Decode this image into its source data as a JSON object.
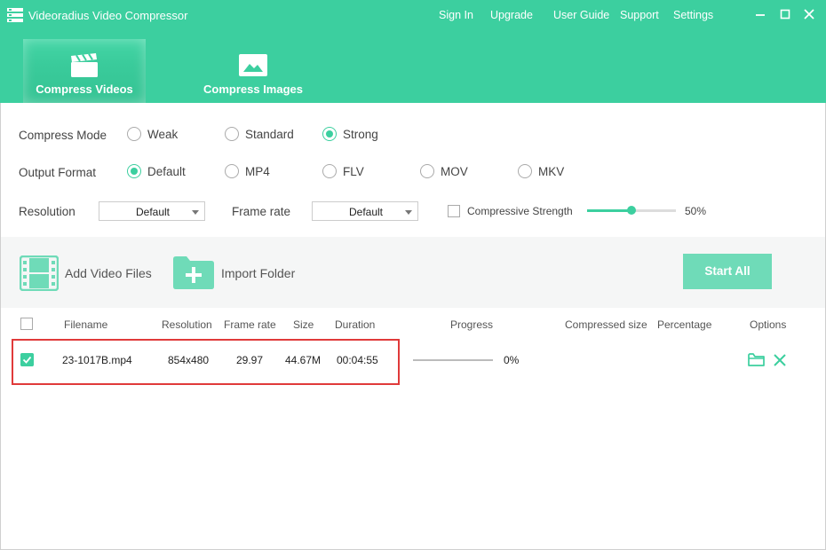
{
  "app": {
    "title": "Videoradius Video Compressor",
    "accent_color": "#3ccf9f",
    "nav": [
      "Sign In",
      "Upgrade",
      "User Guide",
      "Support",
      "Settings"
    ]
  },
  "tabs": [
    {
      "label": "Compress Videos",
      "icon": "clapperboard-icon",
      "active": true
    },
    {
      "label": "Compress Images",
      "icon": "image-icon",
      "active": false
    }
  ],
  "settings": {
    "compress_mode": {
      "label": "Compress Mode",
      "options": [
        "Weak",
        "Standard",
        "Strong"
      ],
      "selected": "Strong"
    },
    "output_format": {
      "label": "Output Format",
      "options": [
        "Default",
        "MP4",
        "FLV",
        "MOV",
        "MKV"
      ],
      "selected": "Default"
    },
    "resolution": {
      "label": "Resolution",
      "value": "Default"
    },
    "frame_rate": {
      "label": "Frame rate",
      "value": "Default"
    },
    "compressive_strength": {
      "label": "Compressive Strength",
      "checked": false,
      "value": "50%",
      "level": 0.5
    }
  },
  "toolbar": {
    "add_files": "Add Video Files",
    "import_folder": "Import Folder",
    "start_all": "Start All"
  },
  "table": {
    "headers": {
      "filename": "Filename",
      "resolution": "Resolution",
      "frame_rate": "Frame rate",
      "size": "Size",
      "duration": "Duration",
      "progress": "Progress",
      "compressed_size": "Compressed size",
      "percentage": "Percentage",
      "options": "Options"
    },
    "rows": [
      {
        "checked": true,
        "filename": "23-1017B.mp4",
        "resolution": "854x480",
        "frame_rate": "29.97",
        "size": "44.67M",
        "duration": "00:04:55",
        "progress": "0%",
        "compressed_size": "",
        "percentage": ""
      }
    ]
  }
}
